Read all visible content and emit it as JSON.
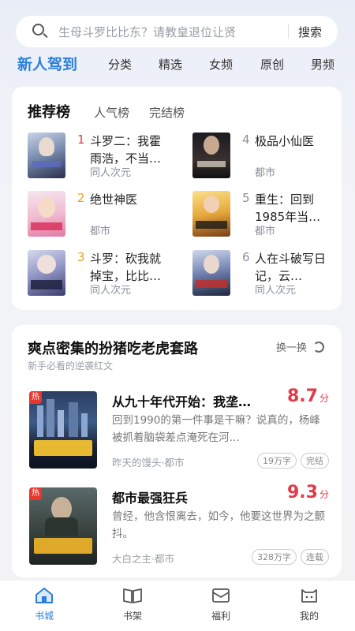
{
  "search": {
    "placeholder": "生母斗罗比比东？请教皇退位让贤",
    "button": "搜索"
  },
  "top_tabs": [
    {
      "label": "新人驾到",
      "active": true
    },
    {
      "label": "分类"
    },
    {
      "label": "精选"
    },
    {
      "label": "女频"
    },
    {
      "label": "原创"
    },
    {
      "label": "男频"
    }
  ],
  "ranking": {
    "tabs": [
      "推荐榜",
      "人气榜",
      "完结榜"
    ],
    "items": [
      {
        "rank": "1",
        "title": "斗罗二：我霍雨浩，不当…",
        "tag": "同人次元"
      },
      {
        "rank": "2",
        "title": "绝世神医",
        "tag": "都市"
      },
      {
        "rank": "3",
        "title": "斗罗：砍我就掉宝，比比…",
        "tag": "同人次元"
      },
      {
        "rank": "4",
        "title": "极品小仙医",
        "tag": "都市"
      },
      {
        "rank": "5",
        "title": "重生：回到1985年当…",
        "tag": "都市"
      },
      {
        "rank": "6",
        "title": "人在斗破写日记，云…",
        "tag": "同人次元"
      }
    ]
  },
  "recommend": {
    "title": "爽点密集的扮猪吃老虎套路",
    "subtitle": "新手必看的逆袭红文",
    "refresh_label": "换一换",
    "hot_label": "热",
    "score_unit": "分",
    "books": [
      {
        "title": "从九十年代开始：我垄…",
        "score": "8.7",
        "desc": "回到1990的第一件事是干嘛？说真的，杨峰被抓着脑袋差点淹死在河…",
        "meta": "昨天的馒头·都市",
        "chips": [
          "19万字",
          "完结"
        ]
      },
      {
        "title": "都市最强狂兵",
        "score": "9.3",
        "desc": "曾经，他含恨离去，如今，他要这世界为之颤抖。",
        "meta": "大白之主·都市",
        "chips": [
          "328万字",
          "连载"
        ]
      }
    ]
  },
  "bottom_nav": [
    {
      "label": "书城",
      "icon": "bookstore-icon",
      "active": true
    },
    {
      "label": "书架",
      "icon": "bookshelf-icon"
    },
    {
      "label": "福利",
      "icon": "welfare-icon"
    },
    {
      "label": "我的",
      "icon": "profile-icon"
    }
  ],
  "colors": {
    "accent": "#2b7fd8",
    "score": "#e23a48",
    "rank_top": "#e23a48",
    "rank_mid": "#f0a020",
    "rank_low": "#8a8f99"
  }
}
